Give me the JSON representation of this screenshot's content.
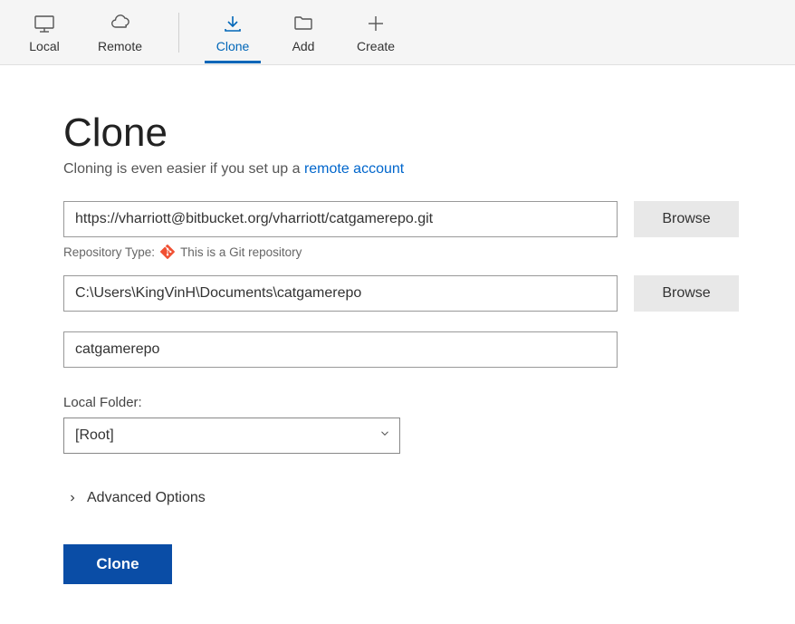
{
  "toolbar": {
    "items": [
      {
        "label": "Local",
        "icon": "monitor-icon",
        "active": false
      },
      {
        "label": "Remote",
        "icon": "cloud-icon",
        "active": false
      },
      {
        "label": "Clone",
        "icon": "download-icon",
        "active": true
      },
      {
        "label": "Add",
        "icon": "folder-icon",
        "active": false
      },
      {
        "label": "Create",
        "icon": "plus-icon",
        "active": false
      }
    ]
  },
  "page": {
    "title": "Clone",
    "subtitle_prefix": "Cloning is even easier if you set up a ",
    "subtitle_link": "remote account"
  },
  "form": {
    "repo_url": "https://vharriott@bitbucket.org/vharriott/catgamerepo.git",
    "browse_label": "Browse",
    "repo_type_label": "Repository Type:",
    "repo_type_text": "This is a Git repository",
    "dest_path": "C:\\Users\\KingVinH\\Documents\\catgamerepo",
    "repo_name": "catgamerepo",
    "local_folder_label": "Local Folder:",
    "local_folder_value": "[Root]",
    "advanced_label": "Advanced Options",
    "submit_label": "Clone"
  }
}
